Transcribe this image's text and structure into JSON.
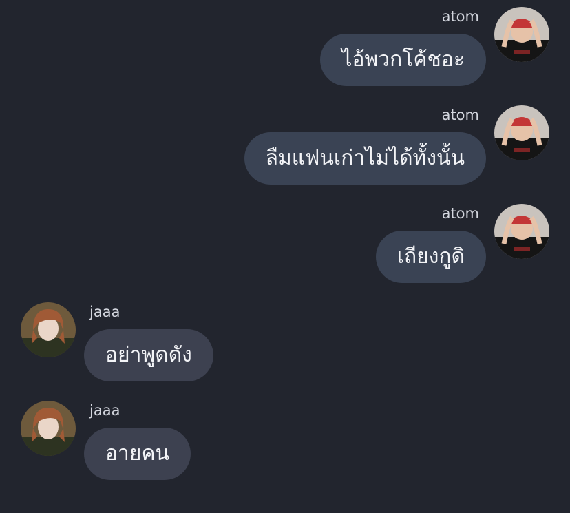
{
  "chat": {
    "outgoing_color": "#3a4354",
    "incoming_color": "#3d4150",
    "messages": [
      {
        "sender": "atom",
        "text": "ไอ้พวกโค้ชอะ",
        "direction": "outgoing",
        "avatar": "atom-avatar"
      },
      {
        "sender": "atom",
        "text": "ลืมแฟนเก่าไม่ได้ทั้งนั้น",
        "direction": "outgoing",
        "avatar": "atom-avatar"
      },
      {
        "sender": "atom",
        "text": "เถียงกูดิ",
        "direction": "outgoing",
        "avatar": "atom-avatar"
      },
      {
        "sender": "jaaa",
        "text": "อย่าพูดดัง",
        "direction": "incoming",
        "avatar": "jaaa-avatar"
      },
      {
        "sender": "jaaa",
        "text": "อายคน",
        "direction": "incoming",
        "avatar": "jaaa-avatar"
      }
    ]
  }
}
